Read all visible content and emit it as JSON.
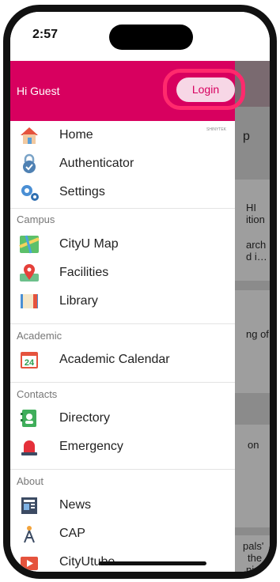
{
  "status": {
    "time": "2:57"
  },
  "drawer": {
    "greeting": "Hi Guest",
    "login_label": "Login",
    "brand": "SHINYTEK",
    "items": [
      {
        "label": "Home",
        "icon": "home-icon"
      },
      {
        "label": "Authenticator",
        "icon": "lock-check-icon"
      },
      {
        "label": "Settings",
        "icon": "gears-icon"
      },
      {
        "label": "CityU Map",
        "icon": "map-icon"
      },
      {
        "label": "Facilities",
        "icon": "location-pin-icon"
      },
      {
        "label": "Library",
        "icon": "book-icon"
      },
      {
        "label": "Academic Calendar",
        "icon": "calendar-icon",
        "day": "24"
      },
      {
        "label": "Directory",
        "icon": "contact-book-icon"
      },
      {
        "label": "Emergency",
        "icon": "siren-icon"
      },
      {
        "label": "News",
        "icon": "news-icon"
      },
      {
        "label": "CAP",
        "icon": "tower-icon"
      },
      {
        "label": "CityUtube",
        "icon": "video-icon"
      }
    ],
    "sections": [
      "Campus",
      "Academic",
      "Contacts",
      "About"
    ]
  },
  "background": {
    "fragments": [
      "p",
      "HI",
      "ition",
      "arch",
      "d i…",
      "ng of",
      "on",
      "pals'",
      "the",
      "nine"
    ]
  },
  "colors": {
    "accent": "#d8005f",
    "login_bg": "#f7d7e6",
    "highlight": "#ff2a6d"
  }
}
